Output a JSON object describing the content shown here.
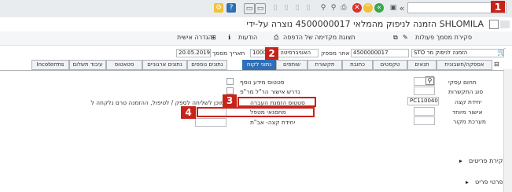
{
  "toolbar": {
    "icons": [
      "expand-icon",
      "save-icon",
      "back-icon",
      "exit-icon",
      "cancel-icon",
      "print-icon",
      "find-icon",
      "find-next-icon",
      "first-page-icon",
      "prev-page-icon",
      "next-page-icon",
      "last-page-icon",
      "new-session-icon",
      "shortcut-icon",
      "help-icon",
      "settings-icon"
    ],
    "command_value": ""
  },
  "title": "הזמנה לניפוק מהמלאי 4500000017 נוצרה על-ידי SHLOMILA",
  "menu": {
    "items": [
      "סקירת מסמך פעולות",
      "תצוגת מקדימה של הדפסה",
      "הודעות",
      "הגדרה אישית"
    ]
  },
  "header": {
    "doc_type": "STO הזמנה לניפוק מר",
    "doc_number": "4500000017",
    "supplier_label": "אתר מספק",
    "supplier_value": "1000 האוניברסיטה העב",
    "date_label": "תאריך מסמך",
    "date_value": "20.05.2019"
  },
  "tabs": [
    "אספקה/חשבונית",
    "תנאים",
    "טקסטים",
    "כתובת",
    "תקשורת",
    "שותפים",
    "נתוני לקוח",
    "נתונים נוספים",
    "נתונים ארגוניים",
    "סטאטוס",
    "עיבוד תשלום",
    "Incoterms"
  ],
  "form": {
    "customer": {
      "label": "תחום עסקי",
      "value": ""
    },
    "txn_type": {
      "label": "סוג התקשרות",
      "value": ""
    },
    "unit": {
      "label": "יחידת קצה",
      "value": "PC110040"
    },
    "special_approval": {
      "label": "אישור מיוחד",
      "value": ""
    },
    "source_system": {
      "label": "מערכת מקור",
      "value": ""
    },
    "extra_info_status": {
      "label": "סטטוס מידע נוסף"
    },
    "requires_approval": {
      "label": "נדרש אישור הר\"ל מר\"פ"
    },
    "order_status": {
      "label": "סטטוס הזמנת העברה",
      "value": "A",
      "desc": "מוכן לשליחה לספק / לטיפול, ההזמנה טרם נלקחה לליקוט במחסן"
    },
    "warehouse": {
      "label": "מחסנאי מטפל",
      "value": ""
    },
    "end_unit_abat": {
      "label": "יחידת קצה- אב\"ת",
      "value": ""
    }
  },
  "sections": {
    "items_review": "סקירת פריטים",
    "item_detail": "פרטי פריט"
  },
  "callouts": [
    "1",
    "2",
    "3",
    "4"
  ],
  "colors": {
    "accent": "#c8231a",
    "tab_active": "#2f6fb7"
  }
}
